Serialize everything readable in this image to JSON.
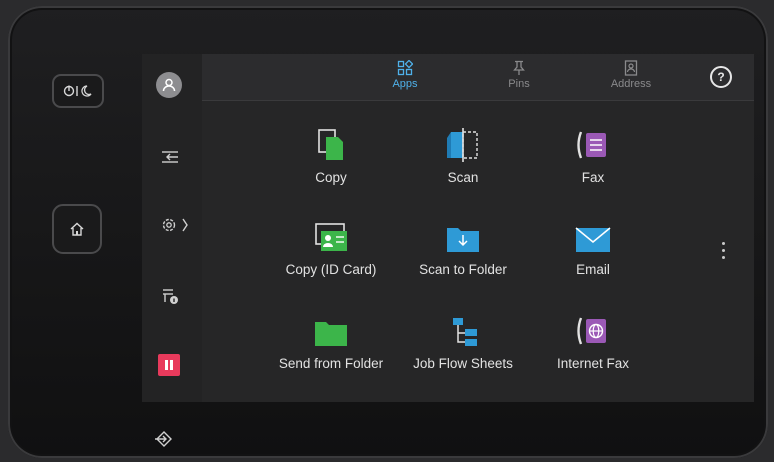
{
  "hardware": {
    "power_label": "power-sleep",
    "home_label": "home"
  },
  "tabs": [
    {
      "label": "Apps",
      "icon": "apps-icon",
      "active": true
    },
    {
      "label": "Pins",
      "icon": "pin-icon",
      "active": false
    },
    {
      "label": "Address",
      "icon": "address-book-icon",
      "active": false
    }
  ],
  "help_label": "?",
  "apps": [
    {
      "label": "Copy",
      "icon": "copy-icon"
    },
    {
      "label": "Scan",
      "icon": "scan-icon"
    },
    {
      "label": "Fax",
      "icon": "fax-icon"
    },
    {
      "label": "Copy (ID Card)",
      "icon": "id-card-copy-icon"
    },
    {
      "label": "Scan to Folder",
      "icon": "scan-to-folder-icon"
    },
    {
      "label": "Email",
      "icon": "email-icon"
    },
    {
      "label": "Send from Folder",
      "icon": "send-from-folder-icon"
    },
    {
      "label": "Job Flow Sheets",
      "icon": "job-flow-icon"
    },
    {
      "label": "Internet Fax",
      "icon": "internet-fax-icon"
    }
  ],
  "colors": {
    "accent_blue": "#4fb1ea",
    "copy_green": "#3cb54a",
    "fax_purple": "#9b59b6",
    "pause_red": "#e83a5c"
  }
}
